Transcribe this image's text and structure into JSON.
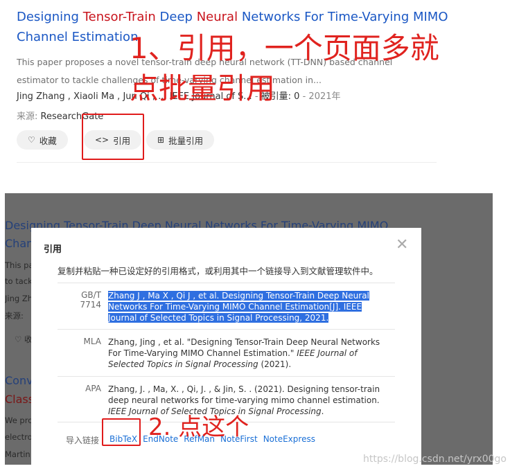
{
  "result": {
    "title_parts": [
      {
        "text": "Designing ",
        "hl": false
      },
      {
        "text": "Tensor-Train",
        "hl": true
      },
      {
        "text": " Deep ",
        "hl": false
      },
      {
        "text": "Neural",
        "hl": true
      },
      {
        "text": " Networks For ",
        "hl": false
      },
      {
        "text": "Time-Varying MIMO Channel Estimation",
        "hl": false
      }
    ],
    "abstract": "This paper proposes a novel tensor-train deep neural network (TT-DNN) based channel estimator to tackle challenges of time-varying channel estimation in...",
    "authors": "Jing Zhang ,  Xiaoli Ma ,  Jun Qi ,  ...",
    "journal": "IEEE Journal of S...",
    "cited_label": "被引量: 0",
    "year": "2021年",
    "source_label": "来源:",
    "source_value": "ResearchGate",
    "btn_collect": "收藏",
    "btn_cite": "引用",
    "btn_batch_cite": "批量引用"
  },
  "annotation_top_line1": "1、引用，一个页面多就",
  "annotation_top_line2": "点批量引用",
  "annotation_bottom": "2. 点这个",
  "background_page": {
    "title_line1": "Designing Tensor-Train Deep Neural Networks For Time-Varying MIMO",
    "title_line2": "Chan",
    "frag_1": "This pa",
    "frag_2": "to tackl",
    "frag_3": "Jing Zh",
    "frag_4": "来源:",
    "frag_5": "♡ 收",
    "second_title_1": "Conv",
    "second_title_2": "Class",
    "frag_6": "We pro",
    "frag_7": "electro",
    "frag_8": "Martin"
  },
  "modal": {
    "title": "引用",
    "close": "✕",
    "desc": "复制并粘贴一种已设定好的引用格式，或利用其中一个链接导入到文献管理软件中。",
    "citations": [
      {
        "format": "GB/T 7714",
        "text": "Zhang J , Ma X , Qi J , et al. Designing Tensor-Train Deep Neural Networks For Time-Varying MIMO Channel Estimation[J]. IEEE Journal of Selected Topics in Signal Processing, 2021."
      },
      {
        "format": "MLA",
        "text_a": "Zhang, Jing , et al. \"Designing Tensor-Train Deep Neural Networks For Time-Varying MIMO Channel Estimation.\" ",
        "text_i": "IEEE Journal of Selected Topics in Signal Processing",
        "text_b": " (2021)."
      },
      {
        "format": "APA",
        "text_a": "Zhang, J. , Ma, X. , Qi, J. , & Jin, S. . (2021). Designing tensor-train deep neural networks for time-varying mimo channel estimation. ",
        "text_i": "IEEE Journal of Selected Topics in Signal Processing",
        "text_b": "."
      }
    ],
    "import_label": "导入链接",
    "import_links": [
      "BibTeX",
      "EndNote",
      "RefMan",
      "NoteFirst",
      "NoteExpress"
    ]
  },
  "watermark": "https://blog.csdn.net/yrx00go",
  "colors": {
    "accent_red": "#e01b1b",
    "link_blue": "#1a57c4",
    "selection": "#2f6fe0"
  }
}
